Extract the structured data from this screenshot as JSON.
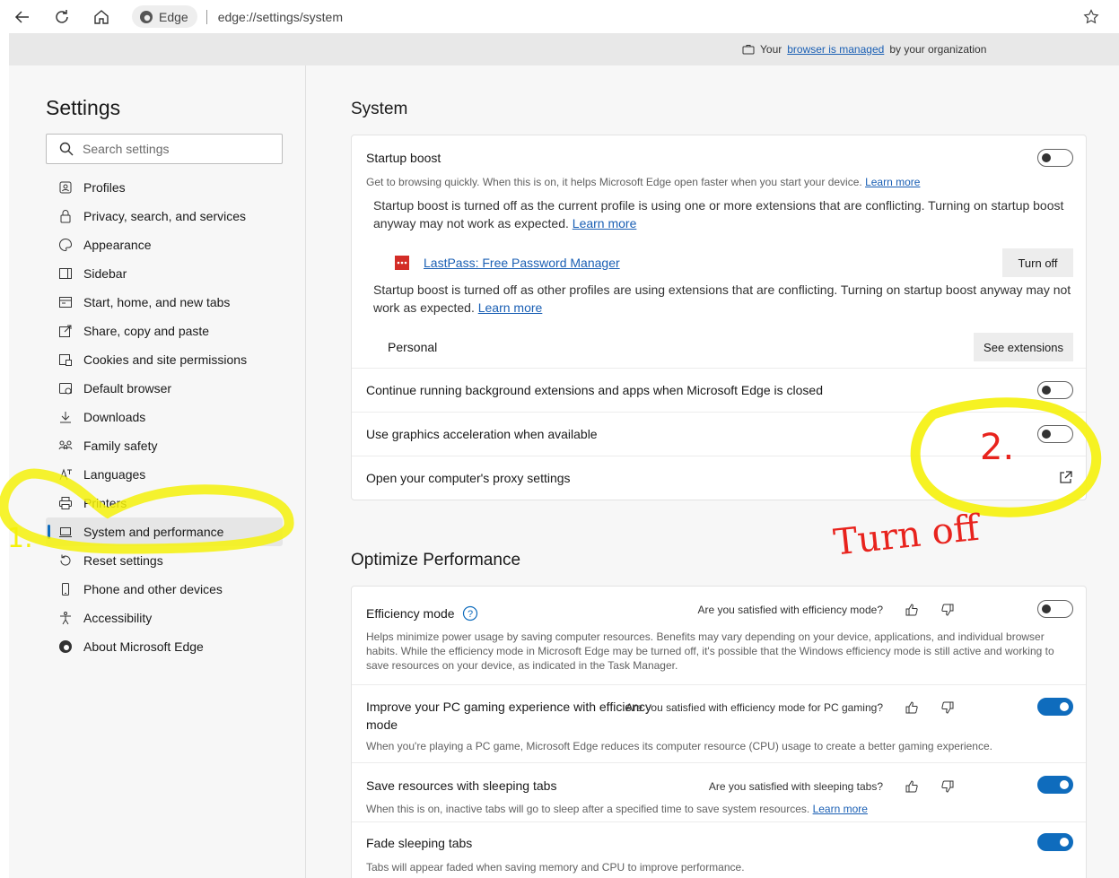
{
  "browser": {
    "edge_label": "Edge",
    "url": "edge://settings/system",
    "managed_prefix": "Your",
    "managed_link": "browser is managed",
    "managed_suffix": "by your organization"
  },
  "sidebar": {
    "title": "Settings",
    "search_placeholder": "Search settings",
    "items": [
      {
        "label": "Profiles",
        "icon": "profile-icon"
      },
      {
        "label": "Privacy, search, and services",
        "icon": "lock-icon"
      },
      {
        "label": "Appearance",
        "icon": "palette-icon"
      },
      {
        "label": "Sidebar",
        "icon": "sidebar-icon"
      },
      {
        "label": "Start, home, and new tabs",
        "icon": "home-tabs-icon"
      },
      {
        "label": "Share, copy and paste",
        "icon": "share-icon"
      },
      {
        "label": "Cookies and site permissions",
        "icon": "cookie-icon"
      },
      {
        "label": "Default browser",
        "icon": "browser-icon"
      },
      {
        "label": "Downloads",
        "icon": "download-icon"
      },
      {
        "label": "Family safety",
        "icon": "family-icon"
      },
      {
        "label": "Languages",
        "icon": "language-icon"
      },
      {
        "label": "Printers",
        "icon": "printer-icon"
      },
      {
        "label": "System and performance",
        "icon": "laptop-icon"
      },
      {
        "label": "Reset settings",
        "icon": "reset-icon"
      },
      {
        "label": "Phone and other devices",
        "icon": "phone-icon"
      },
      {
        "label": "Accessibility",
        "icon": "accessibility-icon"
      },
      {
        "label": "About Microsoft Edge",
        "icon": "edge-icon"
      }
    ],
    "active_index": 12
  },
  "system": {
    "title": "System",
    "startup_boost": {
      "title": "Startup boost",
      "desc": "Get to browsing quickly. When this is on, it helps Microsoft Edge open faster when you start your device.",
      "learn_more": "Learn more",
      "enabled": false,
      "note1": "Startup boost is turned off as the current profile is using one or more extensions that are conflicting. Turning on startup boost anyway may not work as expected.",
      "note1_link": "Learn more",
      "extension_name": "LastPass: Free Password Manager",
      "turn_off": "Turn off",
      "note2": "Startup boost is turned off as other profiles are using extensions that are conflicting. Turning on startup boost anyway may not work as expected.",
      "note2_link": "Learn more",
      "profile_name": "Personal",
      "see_extensions": "See extensions"
    },
    "background": {
      "title": "Continue running background extensions and apps when Microsoft Edge is closed",
      "enabled": false
    },
    "graphics": {
      "title": "Use graphics acceleration when available",
      "enabled": false
    },
    "proxy": {
      "title": "Open your computer's proxy settings"
    }
  },
  "performance": {
    "title": "Optimize Performance",
    "efficiency": {
      "title": "Efficiency mode",
      "question": "Are you satisfied with efficiency mode?",
      "desc": "Helps minimize power usage by saving computer resources. Benefits may vary depending on your device, applications, and individual browser habits. While the efficiency mode in Microsoft Edge may be turned off, it's possible that the Windows efficiency mode is still active and working to save resources on your device, as indicated in the Task Manager.",
      "enabled": false
    },
    "gaming": {
      "title": "Improve your PC gaming experience with efficiency mode",
      "question": "Are you satisfied with efficiency mode for PC gaming?",
      "desc": "When you're playing a PC game, Microsoft Edge reduces its computer resource (CPU) usage to create a better gaming experience.",
      "enabled": true
    },
    "sleeping": {
      "title": "Save resources with sleeping tabs",
      "question": "Are you satisfied with sleeping tabs?",
      "desc": "When this is on, inactive tabs will go to sleep after a specified time to save system resources.",
      "learn_more": "Learn more",
      "enabled": true
    },
    "fade": {
      "title": "Fade sleeping tabs",
      "desc": "Tabs will appear faded when saving memory and CPU to improve performance.",
      "enabled": true
    }
  },
  "annotations": {
    "label1": "1.",
    "label2": "2.",
    "label_turn": "Turn off"
  },
  "colors": {
    "accent": "#0f6cbd",
    "highlight": "#f5f10a",
    "ink_red": "#e8231d"
  }
}
